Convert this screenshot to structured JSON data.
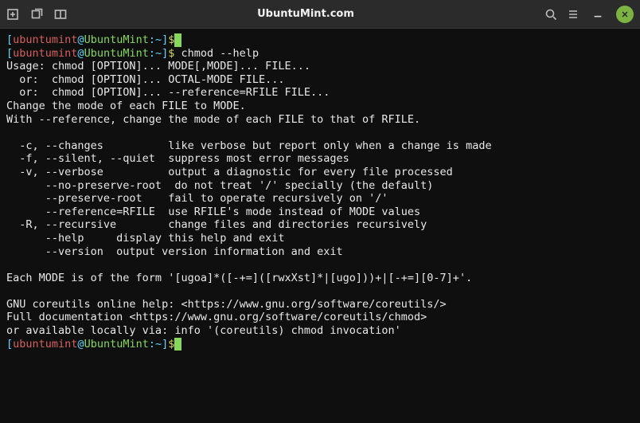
{
  "titlebar": {
    "title": "UbuntuMint.com"
  },
  "prompt": {
    "lb": "[",
    "user": "ubuntumint",
    "at": "@",
    "host": "UbuntuMint",
    "colon": ":",
    "path": "~",
    "rb": "]",
    "dollar": "$"
  },
  "commands": {
    "cmd1": "",
    "cmd2": " chmod --help"
  },
  "out": {
    "l1": "Usage: chmod [OPTION]... MODE[,MODE]... FILE...",
    "l2": "  or:  chmod [OPTION]... OCTAL-MODE FILE...",
    "l3": "  or:  chmod [OPTION]... --reference=RFILE FILE...",
    "l4": "Change the mode of each FILE to MODE.",
    "l5": "With --reference, change the mode of each FILE to that of RFILE.",
    "l6": "",
    "l7": "  -c, --changes          like verbose but report only when a change is made",
    "l8": "  -f, --silent, --quiet  suppress most error messages",
    "l9": "  -v, --verbose          output a diagnostic for every file processed",
    "l10": "      --no-preserve-root  do not treat '/' specially (the default)",
    "l11": "      --preserve-root    fail to operate recursively on '/'",
    "l12": "      --reference=RFILE  use RFILE's mode instead of MODE values",
    "l13": "  -R, --recursive        change files and directories recursively",
    "l14": "      --help     display this help and exit",
    "l15": "      --version  output version information and exit",
    "l16": "",
    "l17": "Each MODE is of the form '[ugoa]*([-+=]([rwxXst]*|[ugo]))+|[-+=][0-7]+'.",
    "l18": "",
    "l19": "GNU coreutils online help: <https://www.gnu.org/software/coreutils/>",
    "l20": "Full documentation <https://www.gnu.org/software/coreutils/chmod>",
    "l21": "or available locally via: info '(coreutils) chmod invocation'"
  }
}
